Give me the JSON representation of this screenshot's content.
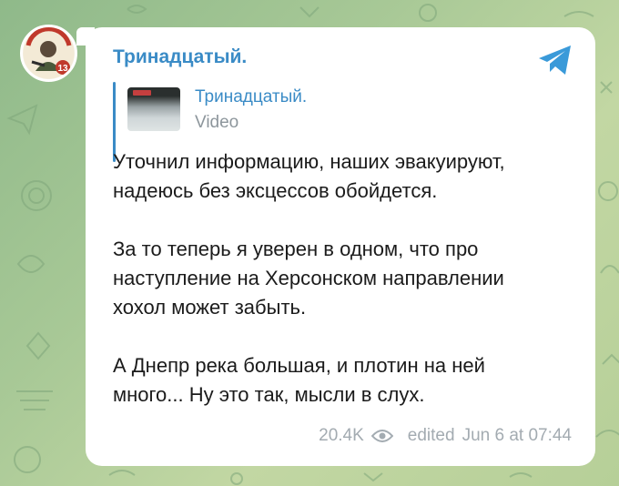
{
  "channel": {
    "name": "Тринадцатый.",
    "avatar_number": "13"
  },
  "forwarded": {
    "from": "Тринадцатый.",
    "type": "Video"
  },
  "message": {
    "paragraphs": [
      "Уточнил информацию, наших эвакуируют,\nнадеюсь без эксцессов обойдется.",
      "За то теперь я уверен в одном, что про\nнаступление на Херсонском направлении\nхохол может забыть.",
      "А Днепр река большая, и плотин на ней\nмного... Ну это так, мысли в слух."
    ]
  },
  "meta": {
    "views": "20.4K",
    "edited": "edited",
    "date": "Jun 6 at 07:44"
  },
  "icons": {
    "share": "telegram-send-icon",
    "views": "eye-icon"
  },
  "colors": {
    "accent": "#3a8bc6",
    "meta": "#a3abb1"
  }
}
